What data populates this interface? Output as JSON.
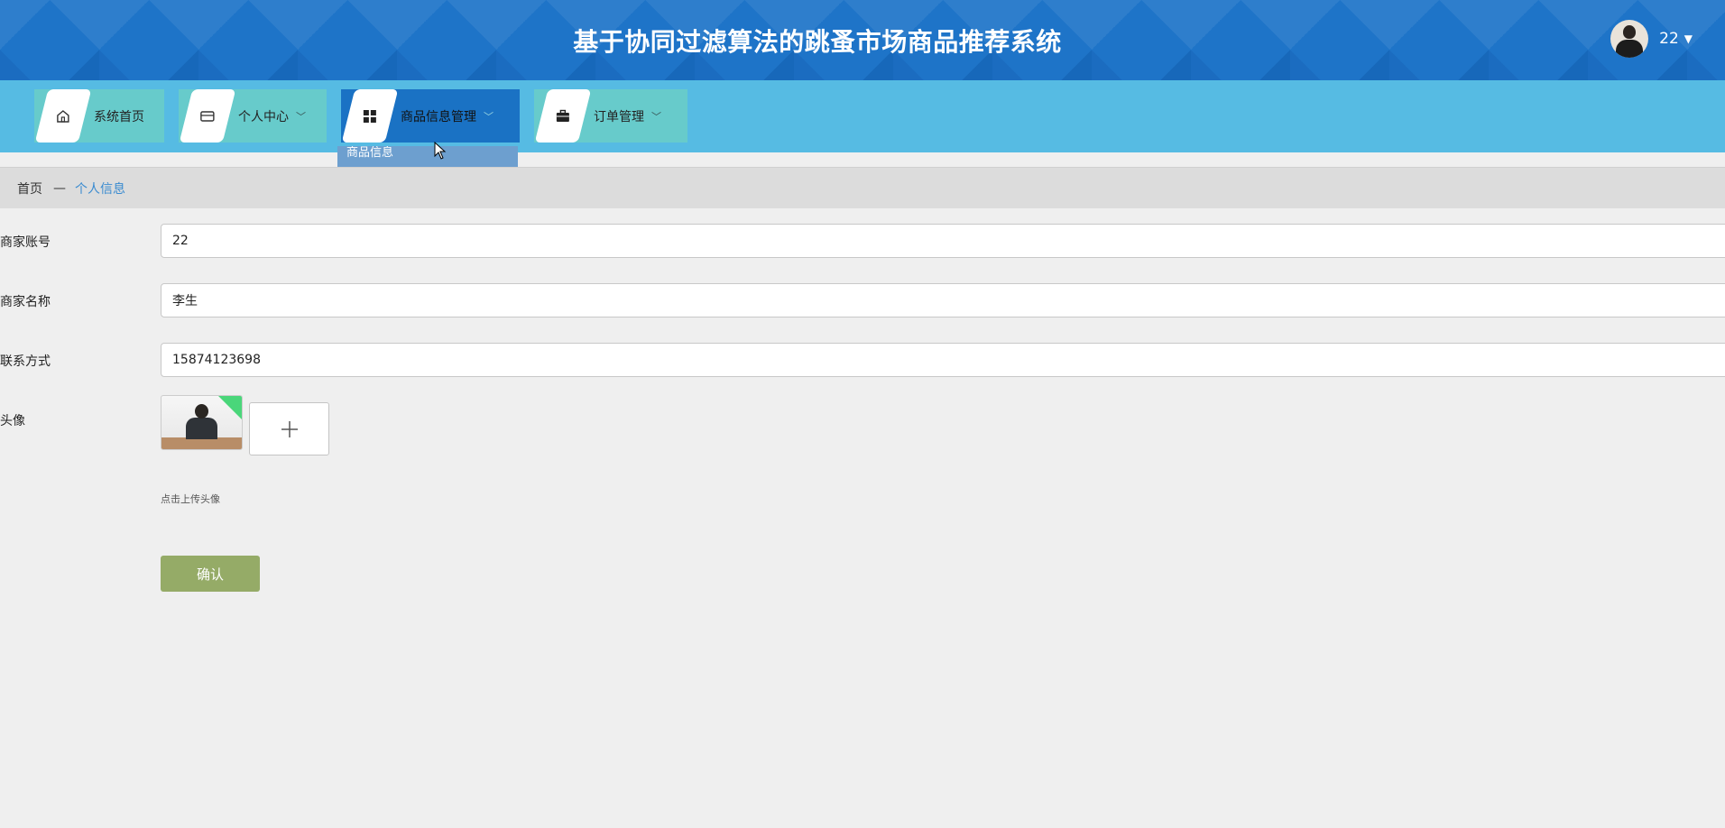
{
  "header": {
    "title": "基于协同过滤算法的跳蚤市场商品推荐系统",
    "username": "22"
  },
  "nav": {
    "items": [
      {
        "label": "系统首页",
        "icon": "home-icon"
      },
      {
        "label": "个人中心",
        "icon": "wallet-icon"
      },
      {
        "label": "商品信息管理",
        "icon": "grid-icon"
      },
      {
        "label": "订单管理",
        "icon": "briefcase-icon"
      }
    ],
    "dropdown_item": "商品信息"
  },
  "breadcrumb": {
    "home": "首页",
    "separator": "—",
    "current": "个人信息"
  },
  "form": {
    "account_label": "商家账号",
    "account_value": "22",
    "name_label": "商家名称",
    "name_value": "李生",
    "contact_label": "联系方式",
    "contact_value": "15874123698",
    "avatar_label": "头像",
    "upload_hint": "点击上传头像",
    "upload_symbol": "+",
    "confirm_label": "确认"
  },
  "colors": {
    "header_bg": "#1a6fc2",
    "navbar_bg": "#56bbe3",
    "nav_item_bg": "#67cbcb",
    "nav_item_active_bg": "#1a72c4",
    "breadcrumb_current": "#3a8bd0",
    "confirm_bg": "#95ab67"
  }
}
